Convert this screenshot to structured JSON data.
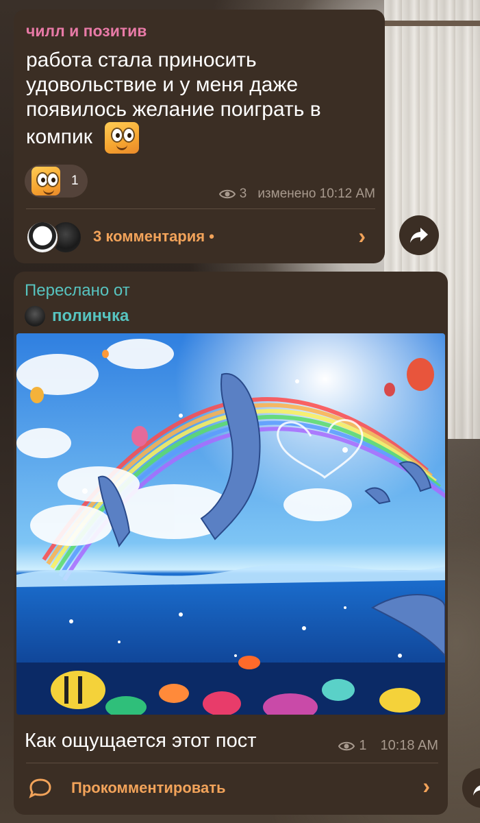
{
  "post1": {
    "channel": "чилл и позитив",
    "text": "работа стала приносить удовольствие и у меня даже появилось желание поиграть в компик",
    "reaction": {
      "emoji": "goofy-face",
      "count": "1"
    },
    "views": "3",
    "edited": "изменено 10:12 AM",
    "comments_label": "3 комментария •"
  },
  "post2": {
    "forwarded_label": "Переслано от",
    "author": "полинчка",
    "image": "dolphins-rainbow-ocean-painting",
    "caption": "Как ощущается этот пост",
    "views": "1",
    "time": "10:18 AM",
    "comment_cta": "Прокомментировать"
  },
  "icons": {
    "chevron": "›",
    "share": "share-arrow-icon"
  },
  "colors": {
    "card_bg": "#3b2e24",
    "accent_orange": "#f2a35a",
    "channel_pink": "#e87aa7",
    "forward_teal": "#57c4c0",
    "meta_gray": "#a89a8e"
  }
}
